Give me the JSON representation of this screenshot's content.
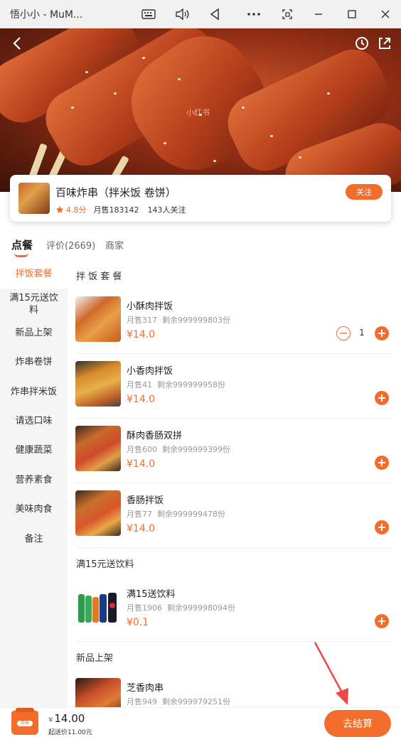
{
  "window": {
    "title": "悟小小 - MuM...",
    "icons": [
      "keyboard-icon",
      "volume-icon",
      "back-triangle-icon",
      "more-icon",
      "screen-icon",
      "minimize-icon",
      "maximize-icon",
      "close-icon"
    ]
  },
  "hero": {
    "watermark": "小红书"
  },
  "shop": {
    "name": "百味炸串（拌米饭 卷饼）",
    "rating": "4.8分",
    "monthly_sales": "月售183142",
    "followers": "143人关注",
    "follow_label": "关注"
  },
  "tabs": [
    {
      "label": "点餐"
    },
    {
      "label": "评价(2669)"
    },
    {
      "label": "商家"
    }
  ],
  "sidebar": {
    "items": [
      {
        "label": "拌饭套餐"
      },
      {
        "label": "满15元送饮料"
      },
      {
        "label": "新品上架"
      },
      {
        "label": "炸串卷饼"
      },
      {
        "label": "炸串拌米饭"
      },
      {
        "label": "请选口味"
      },
      {
        "label": "健康蔬菜"
      },
      {
        "label": "营养素食"
      },
      {
        "label": "美味肉食"
      },
      {
        "label": "备注"
      }
    ]
  },
  "sections": [
    {
      "title": "拌 饭 套 餐",
      "items": [
        {
          "name": "小酥肉拌饭",
          "sales": "月售317",
          "stock": "剩余999999803份",
          "price": "¥14.0",
          "qty": "1"
        },
        {
          "name": "小香肉拌饭",
          "sales": "月售41",
          "stock": "剩余999999958份",
          "price": "¥14.0"
        },
        {
          "name": "酥肉香肠双拼",
          "sales": "月售600",
          "stock": "剩余999999399份",
          "price": "¥14.0"
        },
        {
          "name": "香肠拌饭",
          "sales": "月售77",
          "stock": "剩余999999478份",
          "price": "¥14.0"
        }
      ]
    },
    {
      "title": "满15元送饮料",
      "items": [
        {
          "name": "满15送饮料",
          "sales": "月售1906",
          "stock": "剩余999998094份",
          "price": "¥0.1"
        }
      ]
    },
    {
      "title": "新品上架",
      "items": [
        {
          "name": "芝香肉串",
          "sales": "月售949",
          "stock": "剩余999979251份"
        }
      ]
    }
  ],
  "cart": {
    "currency": "¥",
    "total": "14.00",
    "min_fee": "起送价11.00元",
    "checkout_label": "去结算",
    "bag_label": "百味"
  },
  "colors": {
    "accent": "#f26d2b"
  }
}
